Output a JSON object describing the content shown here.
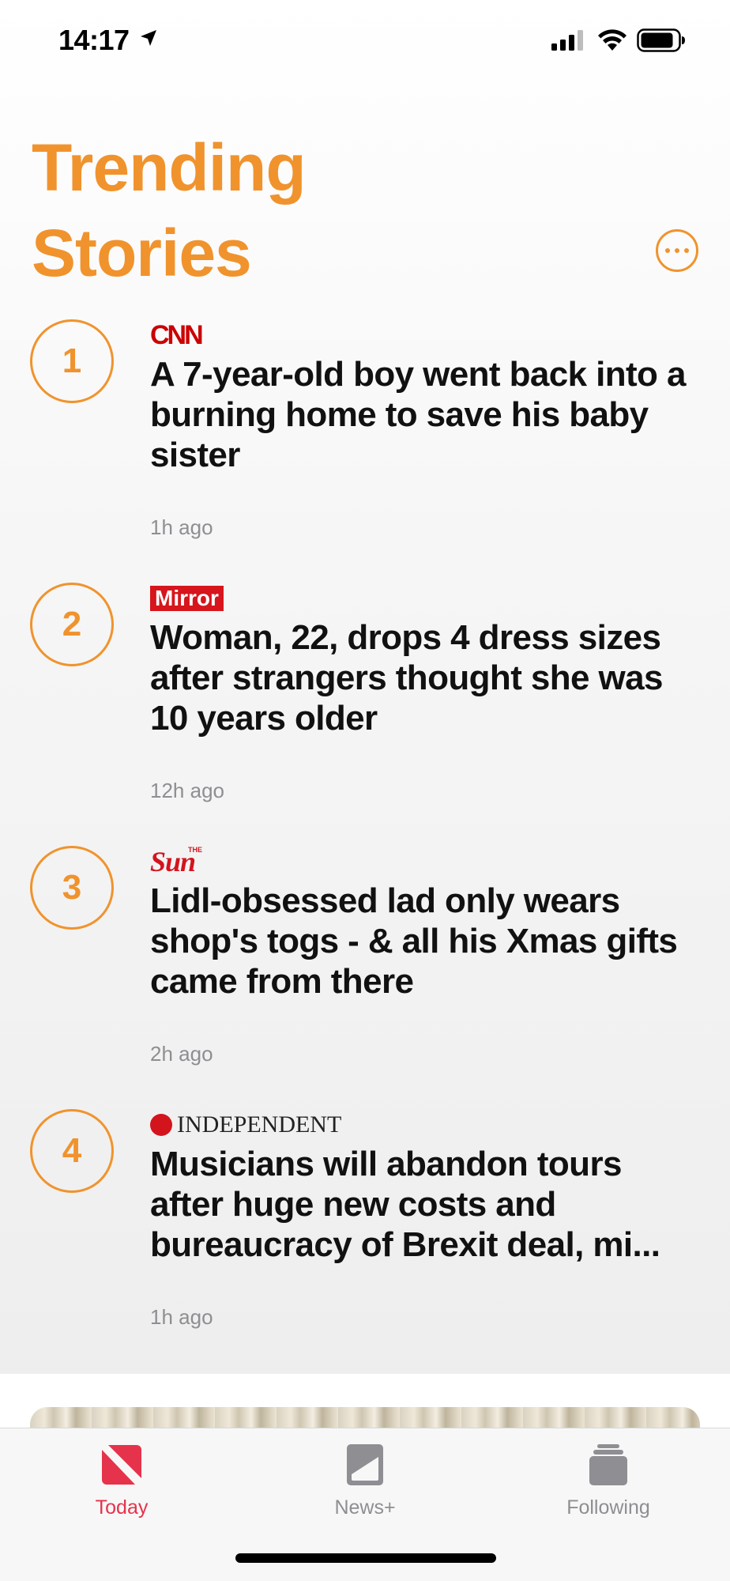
{
  "status_bar": {
    "time": "14:17",
    "icons": [
      "location-arrow-icon",
      "cellular-signal-icon",
      "wifi-icon",
      "battery-icon"
    ]
  },
  "header": {
    "title_line1": "Trending",
    "title_line2": "Stories",
    "more_icon": "ellipsis-circle-icon",
    "accent_color": "#f0932d"
  },
  "stories": [
    {
      "rank": "1",
      "publisher": "CNN",
      "headline": "A 7-year-old boy went back into a burning home to save his baby sister",
      "time": "1h ago"
    },
    {
      "rank": "2",
      "publisher": "Mirror",
      "headline": "Woman, 22, drops 4 dress sizes after strangers thought she was 10 years older",
      "time": "12h ago"
    },
    {
      "rank": "3",
      "publisher": "Sun",
      "publisher_small": "THE",
      "headline": "Lidl-obsessed lad only wears shop's togs - & all his Xmas gifts came from there",
      "time": "2h ago"
    },
    {
      "rank": "4",
      "publisher": "INDEPENDENT",
      "headline": "Musicians will abandon tours after huge new costs and bureaucracy of Brexit deal, mi...",
      "time": "1h ago"
    }
  ],
  "tab_bar": {
    "tabs": [
      {
        "label": "Today",
        "icon": "news-logo-icon",
        "active": true
      },
      {
        "label": "News+",
        "icon": "news-plus-icon",
        "active": false
      },
      {
        "label": "Following",
        "icon": "following-stack-icon",
        "active": false
      }
    ],
    "active_color": "#e5334b",
    "inactive_color": "#8e8e93"
  }
}
